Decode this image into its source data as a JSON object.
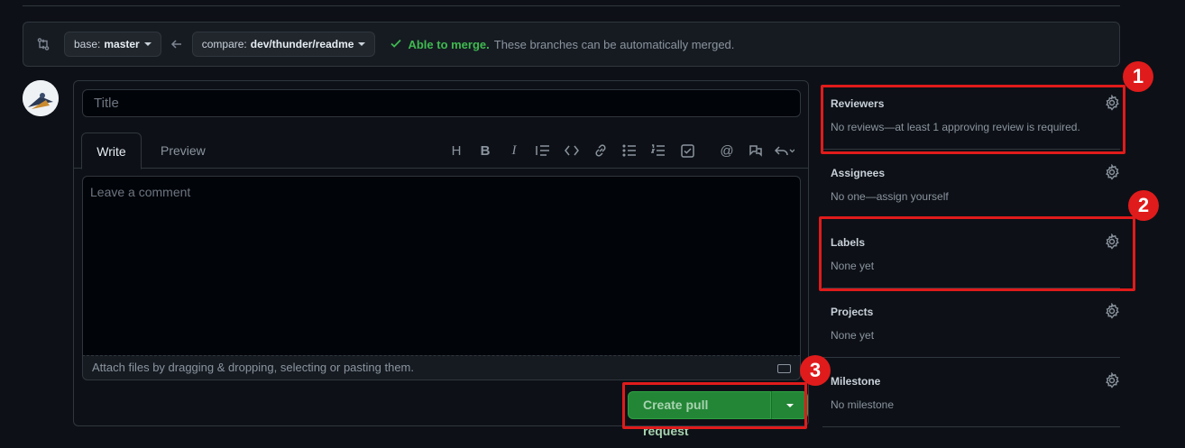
{
  "compare": {
    "base_prefix": "base:",
    "base_branch": "master",
    "compare_prefix": "compare:",
    "compare_branch": "dev/thunder/readme",
    "status_ok": "Able to merge.",
    "status_text": "These branches can be automatically merged."
  },
  "form": {
    "title_placeholder": "Title",
    "tab_write": "Write",
    "tab_preview": "Preview",
    "comment_placeholder": "Leave a comment",
    "attach_text": "Attach files by dragging & dropping, selecting or pasting them.",
    "create_label": "Create pull request"
  },
  "sidebar": {
    "reviewers": {
      "heading": "Reviewers",
      "value": "No reviews—at least 1 approving review is required."
    },
    "assignees": {
      "heading": "Assignees",
      "value": "No one—assign yourself"
    },
    "labels": {
      "heading": "Labels",
      "value": "None yet"
    },
    "projects": {
      "heading": "Projects",
      "value": "None yet"
    },
    "milestone": {
      "heading": "Milestone",
      "value": "No milestone"
    }
  },
  "annotations": {
    "badge1": "1",
    "badge2": "2",
    "badge3": "3"
  },
  "colors": {
    "highlight": "#e01b1b",
    "merge_ok": "#3fb950",
    "primary_button": "#238636"
  }
}
